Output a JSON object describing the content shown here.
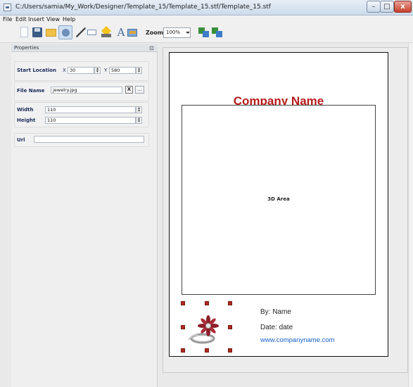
{
  "window": {
    "title": "C:/Users/samia/My_Work/Designer/Template_15/Template_15.stf/Template_15.stf",
    "min_glyph": "–",
    "max_glyph": "□",
    "close_glyph": "x"
  },
  "menu": [
    "File",
    "Edit",
    "Insert",
    "View",
    "Help"
  ],
  "toolbar": {
    "text_tool_glyph": "A",
    "zoom_label": "Zoom",
    "zoom_value": "100%"
  },
  "properties": {
    "title": "Properties",
    "float_glyph": "⊡",
    "start_location_label": "Start Location",
    "x_label": "X",
    "x_value": "30",
    "y_label": "Y",
    "y_value": "580",
    "file_name_label": "File Name",
    "file_name_value": "jewelry.jpg",
    "clear_button": "X",
    "browse_button": "...",
    "width_label": "Width",
    "width_value": "110",
    "height_label": "Height",
    "height_value": "110",
    "url_label": "Url",
    "url_value": ""
  },
  "canvas": {
    "company_name": "Company Name",
    "area_3d_label": "3D Area",
    "by_name": "By: Name",
    "date": "Date: date",
    "website": "www.companyname.com"
  },
  "colors": {
    "company_name": "#b81c1c",
    "website_link": "#1a5fc9",
    "selection_handle": "#b52a1e"
  }
}
